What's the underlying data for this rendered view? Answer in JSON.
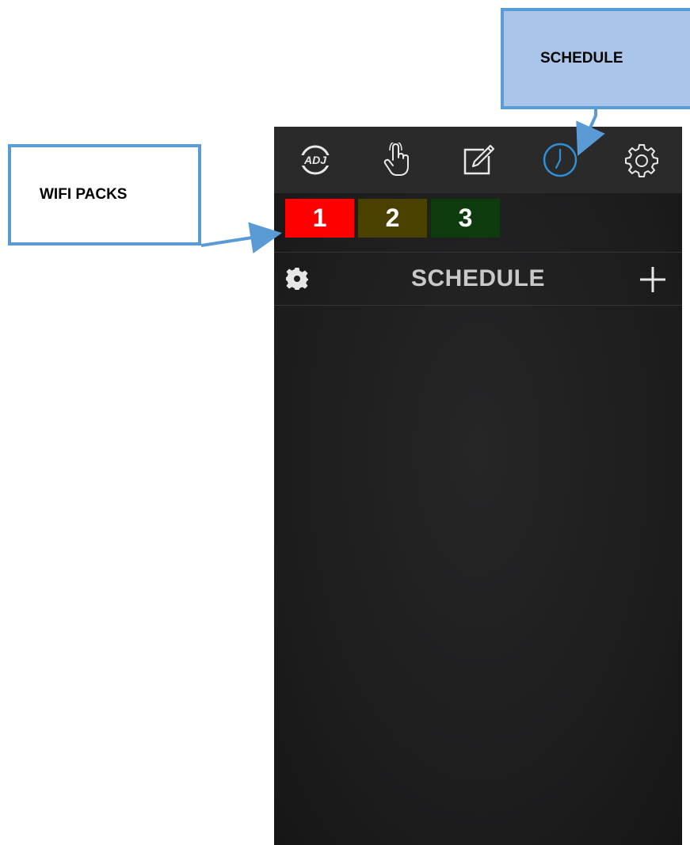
{
  "callouts": {
    "schedule": "SCHEDULE",
    "wifi_packs": "WIFI PACKS"
  },
  "toolbar": {
    "items": [
      {
        "icon": "adj-logo-icon",
        "label": "ADJ"
      },
      {
        "icon": "touch-hand-icon"
      },
      {
        "icon": "edit-icon"
      },
      {
        "icon": "clock-icon",
        "active": true
      },
      {
        "icon": "settings-gear-icon"
      }
    ],
    "active_color": "#2f8fd8"
  },
  "packs": [
    {
      "label": "1",
      "color": "#ff0000",
      "selected": true
    },
    {
      "label": "2",
      "color": "#4a4000"
    },
    {
      "label": "3",
      "color": "#0d3b0d"
    }
  ],
  "schedule_header": {
    "title": "SCHEDULE",
    "left_icon": "gear-icon",
    "right_icon": "plus-icon"
  }
}
